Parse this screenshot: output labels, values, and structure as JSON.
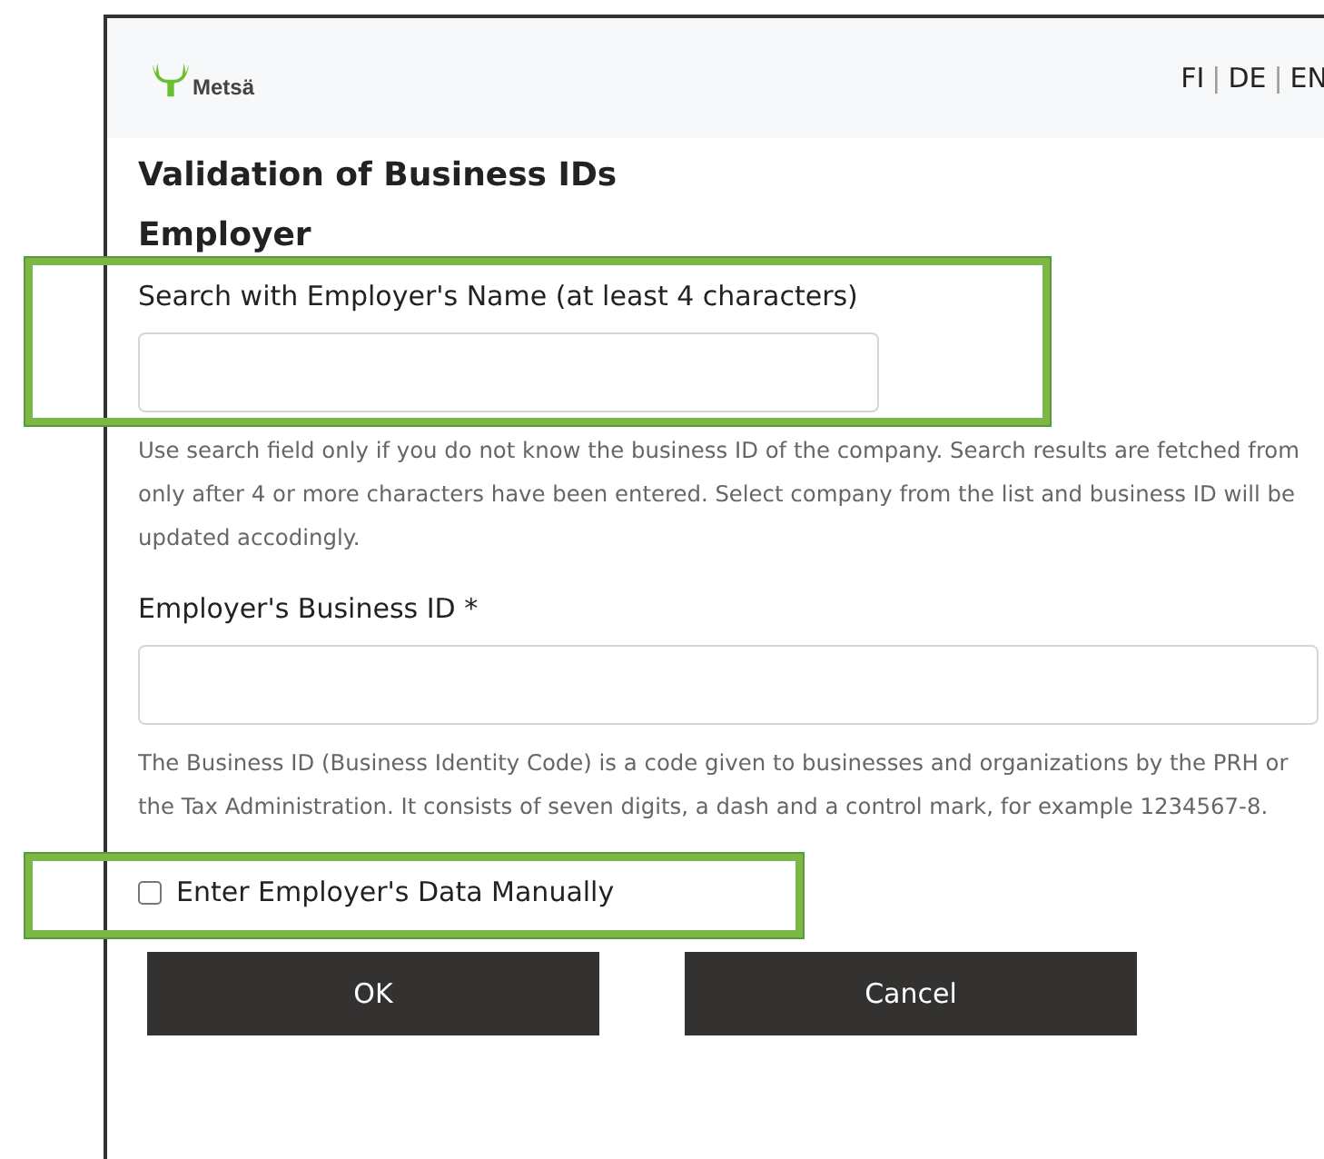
{
  "header": {
    "logo": "Metsä",
    "separator": "|",
    "languages": [
      {
        "label": "FI"
      },
      {
        "label": "DE"
      },
      {
        "label": "EN"
      }
    ]
  },
  "title": "Validation of Business IDs",
  "section": "Employer",
  "fields": [
    {
      "label": "Search with Employer's Name (at least 4 characters)",
      "help": "Use search field only if you do not know the business ID of the company. Search results are fetched from only after 4 or more characters have been entered. Select company from the list and business ID will be updated accodingly.",
      "wide": false,
      "highlighted": true
    },
    {
      "label": "Employer's Business ID *",
      "help": "The Business ID (Business Identity Code) is a code given to businesses and organizations by the PRH or the Tax Administration. It consists of seven digits, a dash and a control mark, for example 1234567-8.",
      "wide": true,
      "highlighted": false
    }
  ],
  "manual": {
    "label": "Enter Employer's Data Manually",
    "checked": false,
    "highlighted": true
  },
  "buttons": [
    "OK",
    "Cancel"
  ]
}
